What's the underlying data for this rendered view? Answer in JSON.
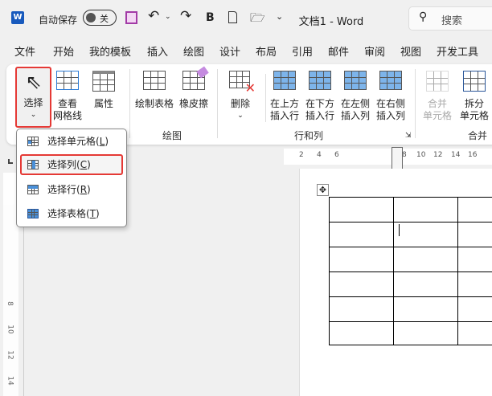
{
  "titlebar": {
    "autosave_label": "自动保存",
    "autosave_state": "关",
    "title": "文档1  -  Word",
    "search_placeholder": "搜索",
    "bold": "B"
  },
  "menu": [
    "文件",
    "开始",
    "我的模板",
    "插入",
    "绘图",
    "设计",
    "布局",
    "引用",
    "邮件",
    "审阅",
    "视图",
    "开发工具"
  ],
  "ribbon": {
    "select": "选择",
    "view_gridlines": [
      "查看",
      "网格线"
    ],
    "properties": "属性",
    "draw_table": "绘制表格",
    "eraser": "橡皮擦",
    "group_draw": "绘图",
    "delete": "删除",
    "insert_above": [
      "在上方",
      "插入行"
    ],
    "insert_below": [
      "在下方",
      "插入行"
    ],
    "insert_left": [
      "在左侧",
      "插入列"
    ],
    "insert_right": [
      "在右侧",
      "插入列"
    ],
    "group_rows_cols": "行和列",
    "merge_cells": [
      "合并",
      "单元格"
    ],
    "split_cells": [
      "拆分",
      "单元格"
    ],
    "group_merge": "合并"
  },
  "select_menu": [
    {
      "label": "选择单元格(",
      "key": "L",
      "end": ")"
    },
    {
      "label": "选择列(",
      "key": "C",
      "end": ")",
      "highlighted": true
    },
    {
      "label": "选择行(",
      "key": "R",
      "end": ")"
    },
    {
      "label": "选择表格(",
      "key": "T",
      "end": ")"
    }
  ],
  "ruler": {
    "h": [
      "2",
      "4",
      "6",
      "8",
      "10",
      "12",
      "14",
      "16"
    ],
    "v": [
      "8",
      "10",
      "12",
      "14"
    ]
  },
  "colors": {
    "accent": "#2b579a",
    "highlight": "#e53935",
    "cell_blue": "#4a90d9"
  }
}
